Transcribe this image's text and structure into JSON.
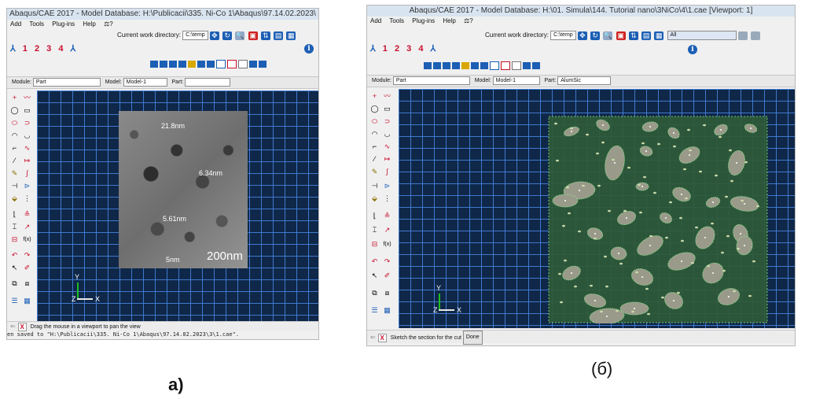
{
  "panel_a": {
    "title": "Abaqus/CAE 2017 - Model Database: H:\\Publicacii\\335. Ni-Co 1\\Abaqus\\97.14.02.2023\\",
    "menu": [
      "Add",
      "Tools",
      "Plug-ins",
      "Help",
      "⚖?"
    ],
    "cwd_label": "Current work directory:",
    "cwd_value": "C:\\temp",
    "steps": [
      "1",
      "2",
      "3",
      "4"
    ],
    "module_label": "Module:",
    "module_value": "Part",
    "model_label": "Model:",
    "model_value": "Model-1",
    "part_label": "Part:",
    "part_value": "",
    "annotations": [
      "21.8nm",
      "6.34nm",
      "5.61nm"
    ],
    "scale_bar": "200nm",
    "scale_small": "5nm",
    "axis_y": "Y",
    "axis_z": "Z",
    "axis_x": "X",
    "prompt": "Drag the mouse in a viewport to pan the view",
    "message": "en saved to \"H:\\Publicacii\\335. Ni-Co 1\\Abaqus\\97.14.02.2023\\3\\1.cae\"."
  },
  "panel_b": {
    "title": "Abaqus/CAE 2017 - Model Database: H:\\01. Simula\\144. Tutorial nano\\3NiCo\\4\\1.cae [Viewport: 1]",
    "menu": [
      "Add",
      "Tools",
      "Plug-ins",
      "Help",
      "⚖?"
    ],
    "cwd_label": "Current work directory:",
    "cwd_value": "C:\\temp",
    "selection_value": "All",
    "steps": [
      "1",
      "2",
      "3",
      "4"
    ],
    "module_label": "Module:",
    "module_value": "Part",
    "model_label": "Model:",
    "model_value": "Model-1",
    "part_label": "Part:",
    "part_value": "AlumSic",
    "axis_y": "Y",
    "axis_z": "Z",
    "axis_x": "X",
    "prompt": "Sketch the section for the cut",
    "done_label": "Done"
  },
  "captions": {
    "a": "a)",
    "b": "(б)"
  },
  "colors": {
    "viewport": "#0f2748",
    "grid": "#4682dc",
    "sketch_fill": "#2f5a38",
    "particle": "#9a9a8a",
    "step_red": "#c8102e"
  }
}
